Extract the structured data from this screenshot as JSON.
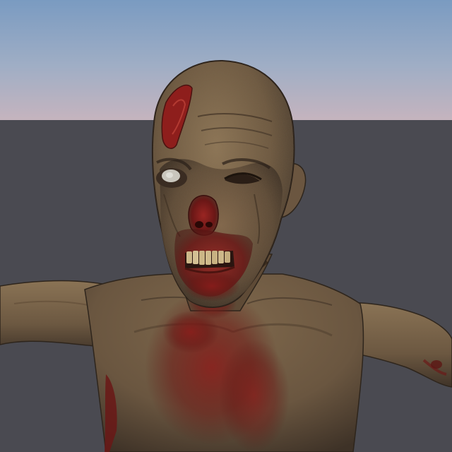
{
  "scene": {
    "subject": "zombie-character-model",
    "colors": {
      "sky_top": "#7d9dc2",
      "sky_mid": "#9cabc3",
      "sky_horizon": "#c4b2bf",
      "ground": "#4a4a51",
      "skin_light": "#8c7456",
      "skin_mid": "#6e5a42",
      "skin_dark": "#3e3226",
      "wound_red": "#8e1e1c",
      "blood_dark": "#5a1412",
      "teeth": "#cdb88a",
      "eye_white": "#c9c6bd"
    }
  }
}
